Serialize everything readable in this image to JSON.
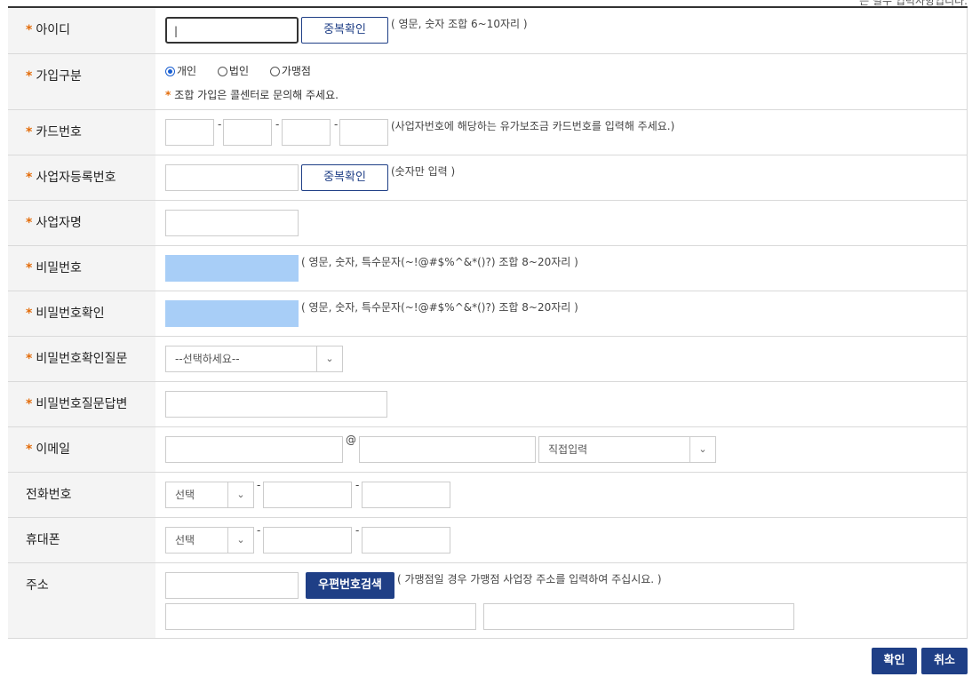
{
  "top_note": "는 필수 입력사항입니다.",
  "required_mark": "*",
  "rows": {
    "id": {
      "label": "아이디",
      "value": "|",
      "check_button": "중복확인",
      "hint": "( 영문, 숫자 조합 6~10자리 )"
    },
    "join_type": {
      "label": "가입구분",
      "options": [
        {
          "label": "개인",
          "selected": true
        },
        {
          "label": "법인",
          "selected": false
        },
        {
          "label": "가맹점",
          "selected": false
        }
      ],
      "note_mark": "*",
      "note": "조합 가입은 콜센터로 문의해 주세요."
    },
    "card": {
      "label": "카드번호",
      "sep": "-",
      "hint": "(사업자번호에 해당하는 유가보조금 카드번호를 입력해 주세요.)"
    },
    "biz_no": {
      "label": "사업자등록번호",
      "check_button": "중복확인",
      "hint": "(숫자만 입력 )"
    },
    "biz_name": {
      "label": "사업자명"
    },
    "password": {
      "label": "비밀번호",
      "hint": "( 영문, 숫자, 특수문자(~!@#$%^&*()?) 조합 8~20자리 )"
    },
    "password_confirm": {
      "label": "비밀번호확인",
      "hint": "( 영문, 숫자, 특수문자(~!@#$%^&*()?) 조합 8~20자리 )"
    },
    "pw_question": {
      "label": "비밀번호확인질문",
      "selected": "--선택하세요--"
    },
    "pw_answer": {
      "label": "비밀번호질문답변"
    },
    "email": {
      "label": "이메일",
      "at": "@",
      "domain_select": "직접입력"
    },
    "phone": {
      "label": "전화번호",
      "select": "선택",
      "sep": "-"
    },
    "mobile": {
      "label": "휴대폰",
      "select": "선택",
      "sep": "-"
    },
    "address": {
      "label": "주소",
      "search_button": "우편번호검색",
      "hint": "( 가맹점일 경우 가맹점 사업장 주소를 입력하여 주십시요. )"
    }
  },
  "actions": {
    "confirm": "확인",
    "cancel": "취소"
  },
  "icons": {
    "dropdown": "chevron-down-icon"
  },
  "colors": {
    "accent": "#1f3f86",
    "required": "#e36c0a",
    "password_fill": "#a8cef7",
    "radio": "#1a5fd1"
  }
}
